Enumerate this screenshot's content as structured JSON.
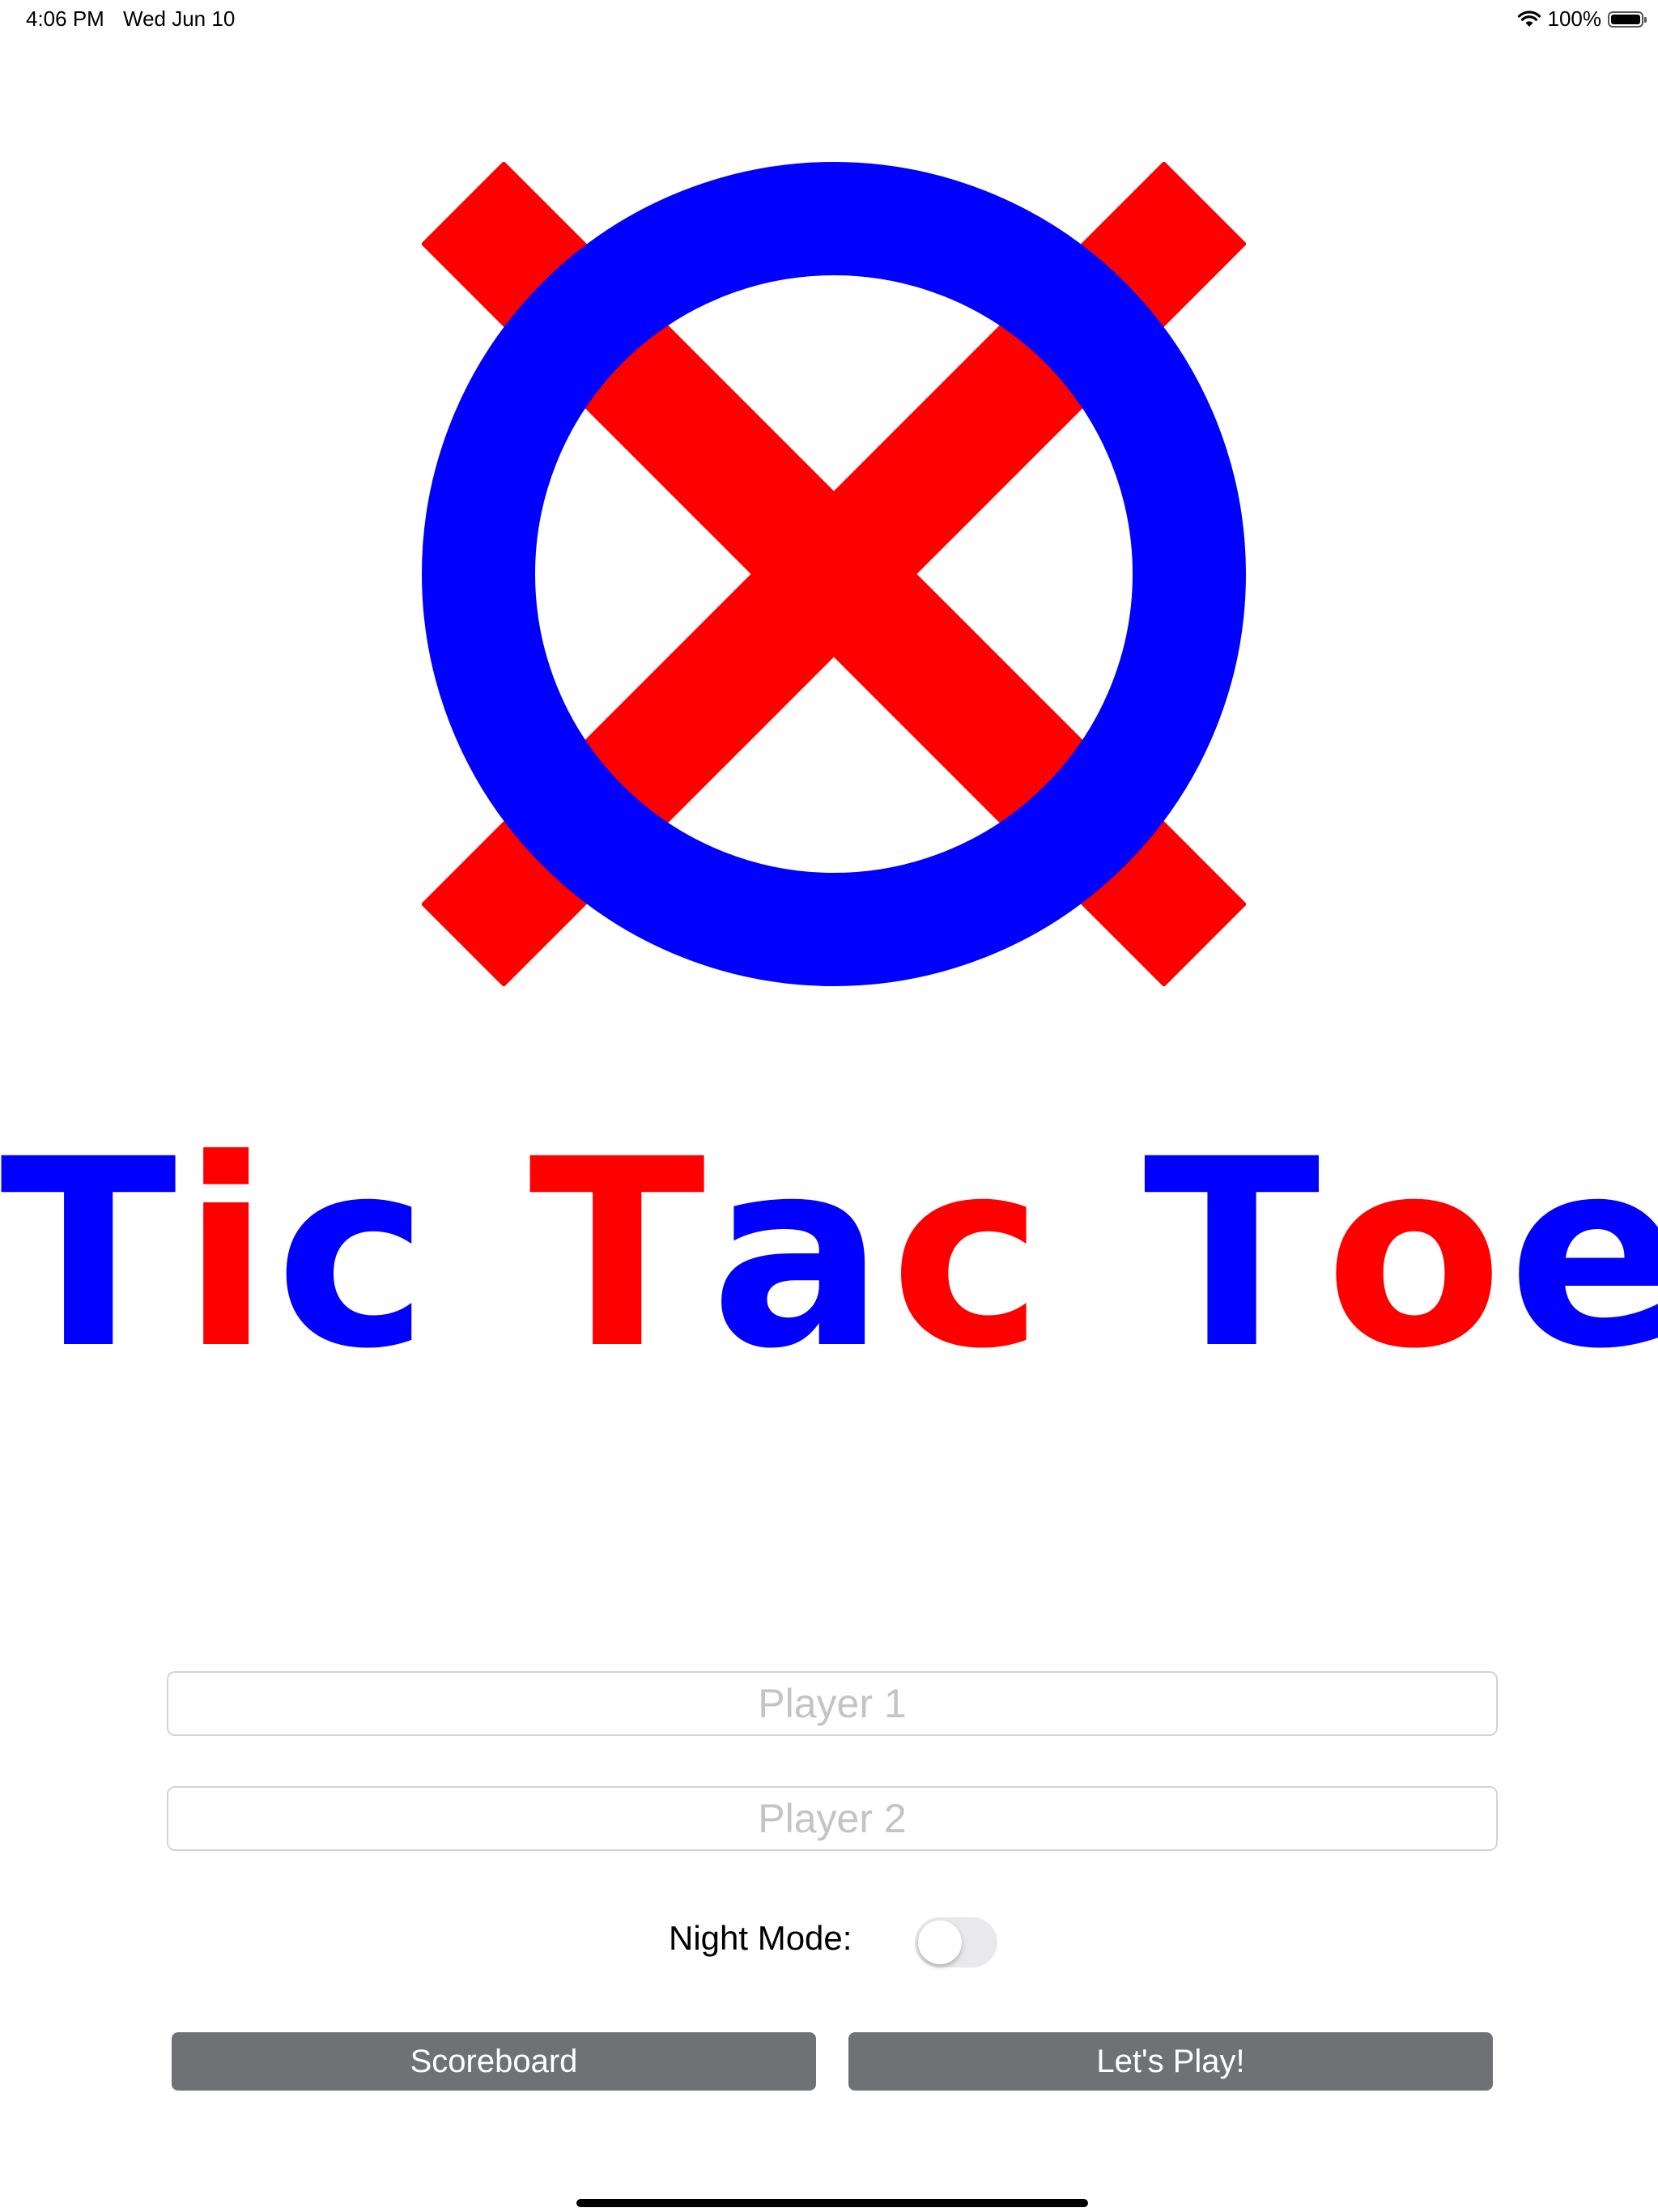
{
  "status_bar": {
    "time": "4:06 PM",
    "date": "Wed Jun 10",
    "battery": "100%",
    "wifi_icon": "wifi-icon",
    "battery_icon": "battery-icon"
  },
  "logo": {
    "icon": "tic-tac-toe-logo-icon",
    "x_color": "#ff0000",
    "o_color": "#0000ff"
  },
  "title": {
    "letters": [
      {
        "char": "T",
        "color": "#0000ff"
      },
      {
        "char": "i",
        "color": "#ff0000"
      },
      {
        "char": "c",
        "color": "#0000ff"
      },
      {
        "char": " ",
        "color": "#000000"
      },
      {
        "char": "T",
        "color": "#ff0000"
      },
      {
        "char": "a",
        "color": "#0000ff"
      },
      {
        "char": "c",
        "color": "#ff0000"
      },
      {
        "char": " ",
        "color": "#000000"
      },
      {
        "char": "T",
        "color": "#0000ff"
      },
      {
        "char": "o",
        "color": "#ff0000"
      },
      {
        "char": "e",
        "color": "#0000ff"
      }
    ]
  },
  "form": {
    "player1": {
      "value": "",
      "placeholder": "Player 1"
    },
    "player2": {
      "value": "",
      "placeholder": "Player 2"
    },
    "night_mode": {
      "label": "Night Mode:",
      "on": false
    }
  },
  "buttons": {
    "scoreboard": "Scoreboard",
    "play": "Let's Play!",
    "color": "#6f7175"
  }
}
